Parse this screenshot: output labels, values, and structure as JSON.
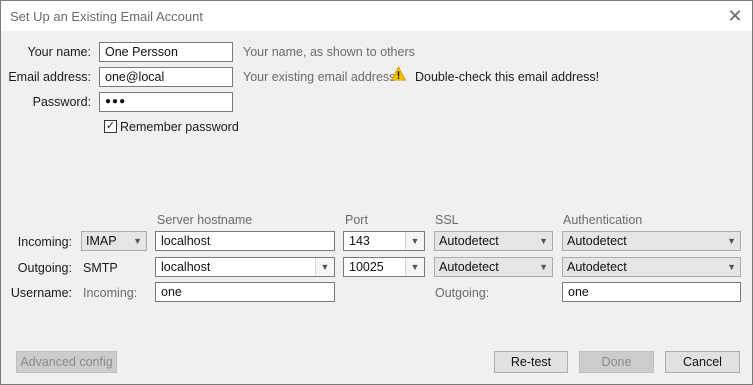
{
  "window": {
    "title": "Set Up an Existing Email Account",
    "close_glyph": "✕"
  },
  "identity": {
    "name_label": "Your name:",
    "name_value": "One Persson",
    "name_hint": "Your name, as shown to others",
    "email_label": "Email address:",
    "email_value": "one@local",
    "email_hint": "Your existing email address",
    "email_warning": "Double-check this email address!",
    "password_label": "Password:",
    "password_value": "●●●",
    "remember_label": "Remember password",
    "remember_checked": true
  },
  "server_table": {
    "headers": {
      "hostname": "Server hostname",
      "port": "Port",
      "ssl": "SSL",
      "auth": "Authentication"
    },
    "incoming": {
      "label": "Incoming:",
      "protocol": "IMAP",
      "hostname": "localhost",
      "port": "143",
      "ssl": "Autodetect",
      "auth": "Autodetect"
    },
    "outgoing": {
      "label": "Outgoing:",
      "protocol": "SMTP",
      "hostname": "localhost",
      "port": "10025",
      "ssl": "Autodetect",
      "auth": "Autodetect"
    },
    "username": {
      "label": "Username:",
      "incoming_label": "Incoming:",
      "incoming_value": "one",
      "outgoing_label": "Outgoing:",
      "outgoing_value": "one"
    }
  },
  "buttons": {
    "advanced": "Advanced config",
    "retest": "Re-test",
    "done": "Done",
    "cancel": "Cancel"
  },
  "icons": {
    "warning": "warning-icon",
    "close": "close-icon",
    "dropdown": "chevron-down-icon"
  }
}
